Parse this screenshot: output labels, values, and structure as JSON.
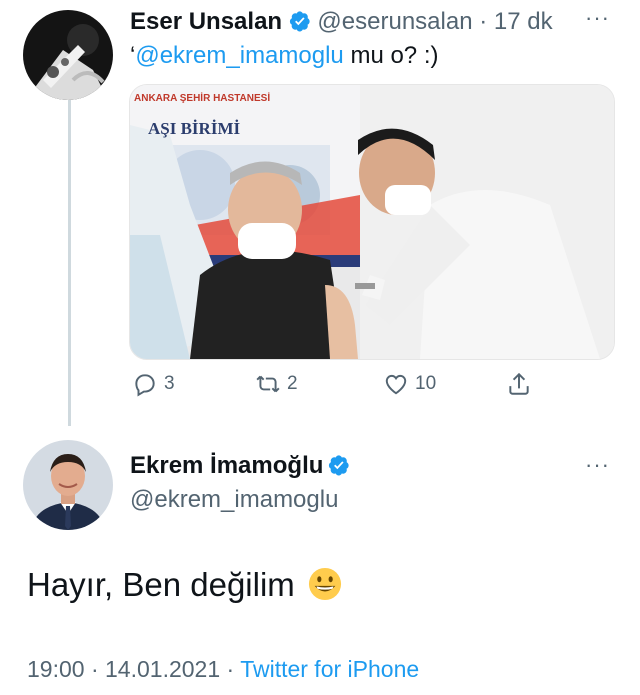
{
  "quoted_tweet": {
    "author_name": "Eser Unsalan",
    "handle": "@eserunsalan",
    "separator": "·",
    "time_ago": "17 dk",
    "text_prefix": "‘",
    "mention": "@ekrem_imamoglu",
    "text_rest": " mu o? :)",
    "image": {
      "sign_hospital": "ANKARA ŞEHİR HASTANESİ",
      "sign_unit": "AŞI BİRİMİ"
    },
    "stats": {
      "replies": "3",
      "retweets": "2",
      "likes": "10"
    }
  },
  "main_tweet": {
    "author_name": "Ekrem İmamoğlu",
    "handle": "@ekrem_imamoglu",
    "text": "Hayır, Ben değilim",
    "emoji": "😀",
    "time": "19:00",
    "date": "14.01.2021",
    "separator": "·",
    "source": "Twitter for iPhone"
  },
  "icons": [
    "verified-badge-icon",
    "more-icon",
    "reply-icon",
    "retweet-icon",
    "like-icon",
    "share-icon",
    "grinning-emoji-icon"
  ],
  "colors": {
    "accent": "#1d9bf0",
    "muted": "#536471",
    "text": "#0f1419",
    "thread_line": "#cfd9de"
  }
}
